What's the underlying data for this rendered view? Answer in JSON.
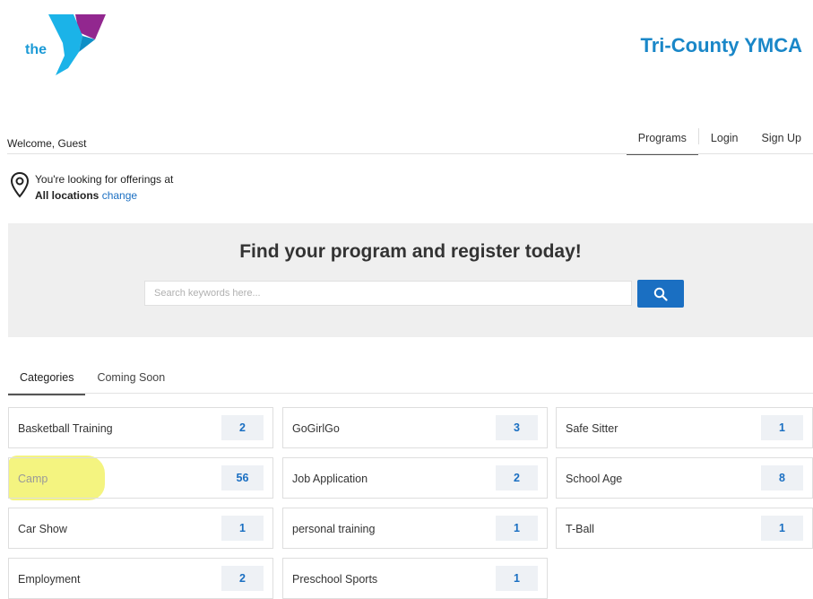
{
  "brand": {
    "logo_text": "the",
    "logo_sub": "YMCA",
    "org_name": "Tri-County YMCA",
    "colors": {
      "accent": "#1a87c8",
      "logo_blue": "#1bb3e8",
      "logo_purple": "#92278f",
      "primary_button": "#1a6fc2"
    }
  },
  "header": {
    "welcome": "Welcome, Guest",
    "nav": [
      {
        "label": "Programs",
        "active": true
      },
      {
        "label": "Login",
        "active": false
      },
      {
        "label": "Sign Up",
        "active": false
      }
    ]
  },
  "location": {
    "line1": "You're looking for offerings at",
    "value": "All locations",
    "change_link": "change",
    "icon": "map-pin-icon"
  },
  "hero": {
    "title": "Find your program and register today!",
    "search_placeholder": "Search keywords here...",
    "search_value": "",
    "search_icon": "search-icon"
  },
  "tabs": [
    {
      "label": "Categories",
      "active": true
    },
    {
      "label": "Coming Soon",
      "active": false
    }
  ],
  "categories": [
    {
      "label": "Basketball Training",
      "count": "2"
    },
    {
      "label": "GoGirlGo",
      "count": "3"
    },
    {
      "label": "Safe Sitter",
      "count": "1"
    },
    {
      "label": "Camp",
      "count": "56",
      "highlighted": true
    },
    {
      "label": "Job Application",
      "count": "2"
    },
    {
      "label": "School Age",
      "count": "8"
    },
    {
      "label": "Car Show",
      "count": "1"
    },
    {
      "label": "personal training",
      "count": "1"
    },
    {
      "label": "T-Ball",
      "count": "1"
    },
    {
      "label": "Employment",
      "count": "2"
    },
    {
      "label": "Preschool Sports",
      "count": "1"
    }
  ]
}
